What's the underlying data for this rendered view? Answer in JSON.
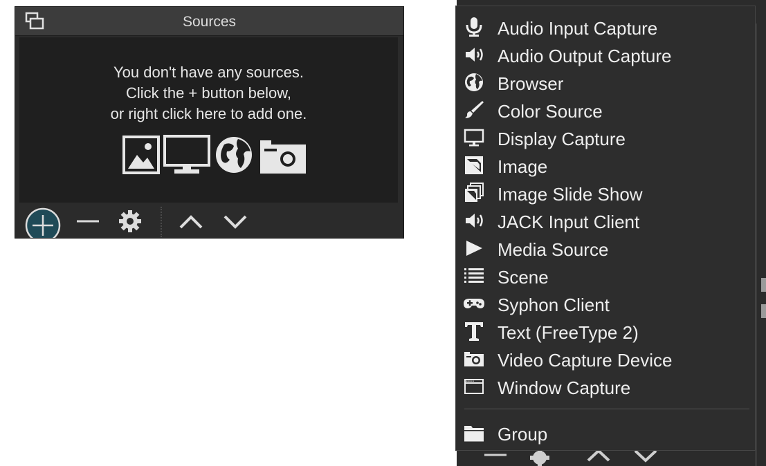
{
  "sources_dock": {
    "title": "Sources",
    "empty_message": {
      "line1": "You don't have any sources.",
      "line2": "Click the + button below,",
      "line3": "or right click here to add one."
    },
    "toolbar": {
      "buttons": [
        "add-icon",
        "remove-icon",
        "gear-icon",
        "move-up-icon",
        "move-down-icon"
      ]
    }
  },
  "context_menu": {
    "items": [
      {
        "label": "Audio Input Capture",
        "icon": "microphone-icon"
      },
      {
        "label": "Audio Output Capture",
        "icon": "speaker-icon"
      },
      {
        "label": "Browser",
        "icon": "globe-icon"
      },
      {
        "label": "Color Source",
        "icon": "brush-icon"
      },
      {
        "label": "Display Capture",
        "icon": "monitor-icon"
      },
      {
        "label": "Image",
        "icon": "image-icon"
      },
      {
        "label": "Image Slide Show",
        "icon": "slideshow-icon"
      },
      {
        "label": "JACK Input Client",
        "icon": "speaker-icon"
      },
      {
        "label": "Media Source",
        "icon": "play-icon"
      },
      {
        "label": "Scene",
        "icon": "list-icon"
      },
      {
        "label": "Syphon Client",
        "icon": "gamepad-icon"
      },
      {
        "label": "Text (FreeType 2)",
        "icon": "text-icon"
      },
      {
        "label": "Video Capture Device",
        "icon": "camera-icon"
      },
      {
        "label": "Window Capture",
        "icon": "window-icon"
      }
    ],
    "group_item": {
      "label": "Group",
      "icon": "folder-icon"
    }
  },
  "colors": {
    "dock_bg": "#2b2b2b",
    "dock_body": "#1f1f1f",
    "menu_bg": "#2d2d2d",
    "text": "#eeeeee",
    "add_button_fill": "#1f4a57"
  }
}
